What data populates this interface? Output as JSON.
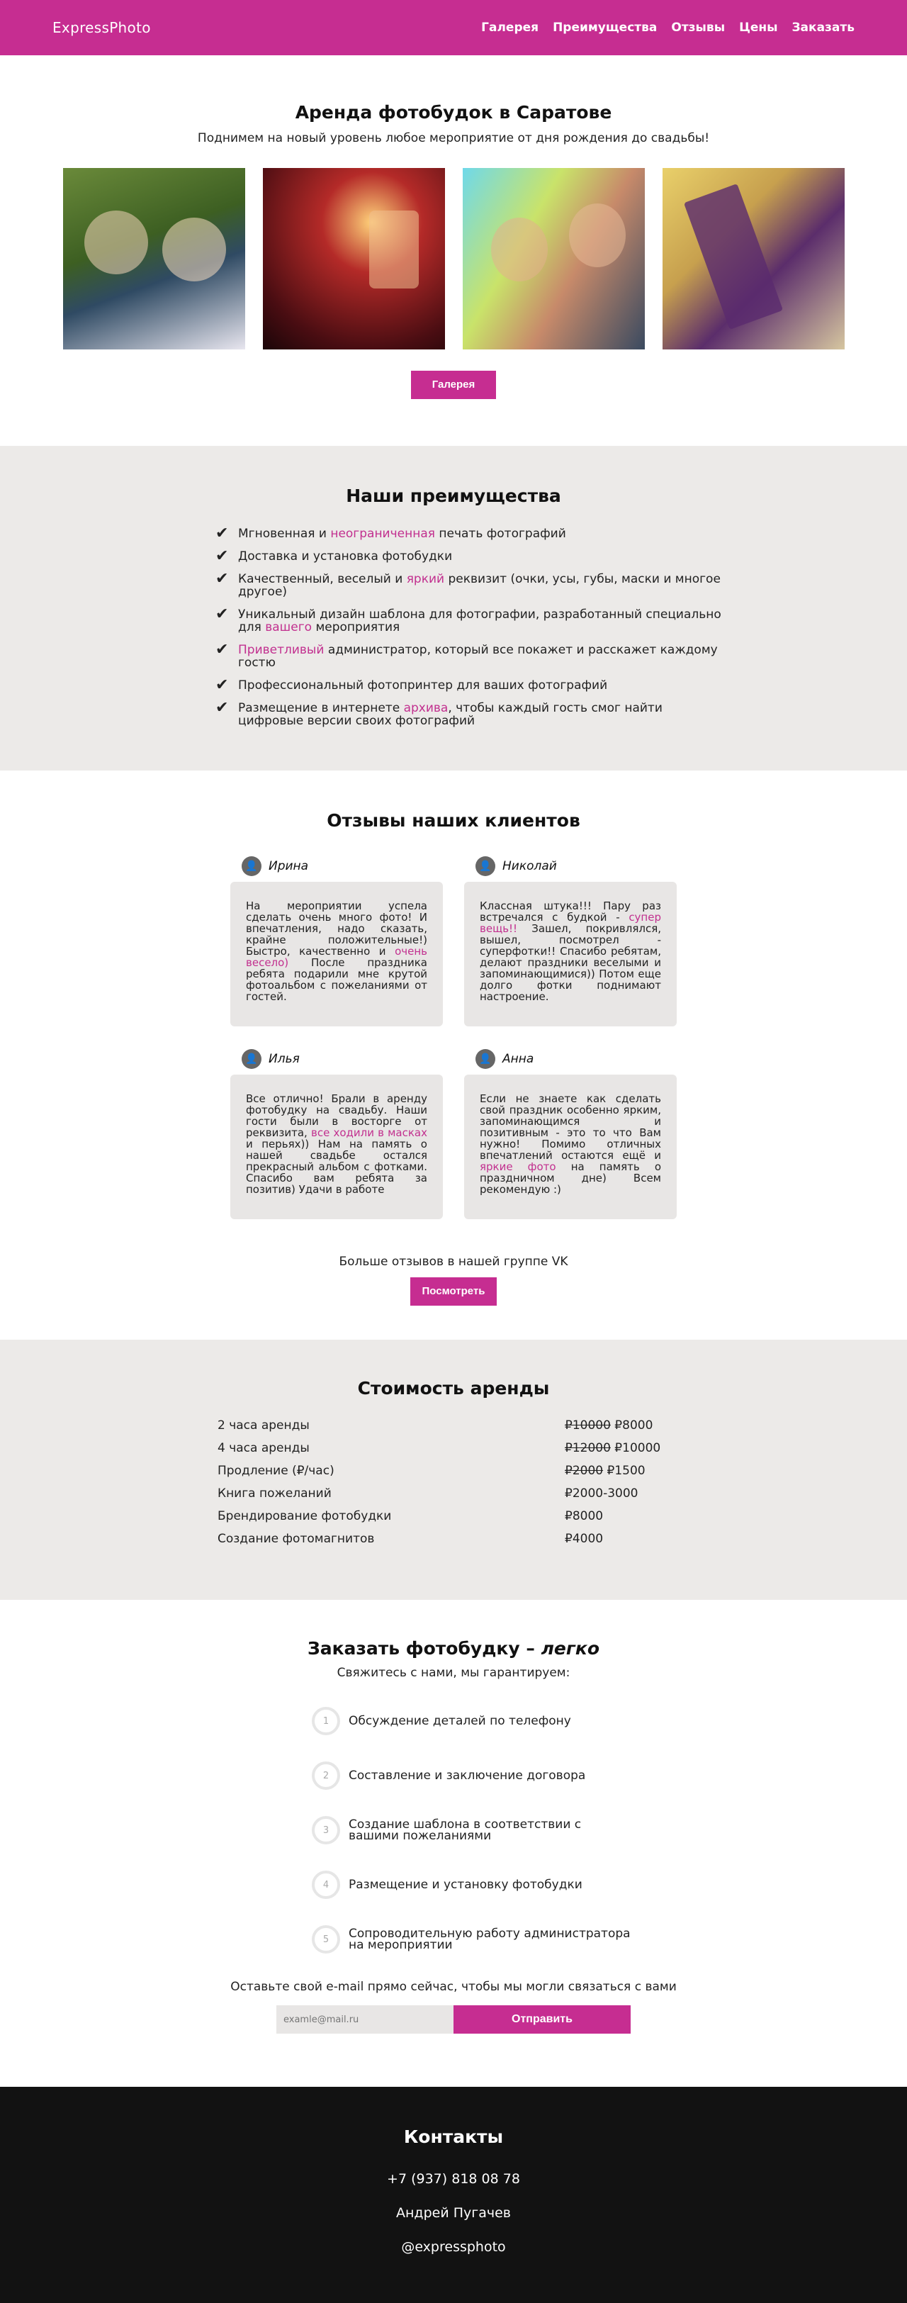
{
  "header": {
    "logo": "ExpressPhoto",
    "nav": [
      "Галерея",
      "Преимущества",
      "Отзывы",
      "Цены",
      "Заказать"
    ]
  },
  "gallery": {
    "title": "Аренда фотобудок в Саратове",
    "subtitle": "Поднимем на новый уровень любое мероприятие от дня рождения до свадьбы!",
    "button": "Галерея"
  },
  "advantages": {
    "title": "Наши преимущества",
    "items": [
      {
        "before": "Мгновенная и ",
        "accent": "неограниченная",
        "after": " печать фотографий"
      },
      {
        "before": "Доставка и установка фотобудки",
        "accent": "",
        "after": ""
      },
      {
        "before": "Качественный, веселый и ",
        "accent": "яркий",
        "after": " реквизит (очки, усы, губы, маски и многое другое)"
      },
      {
        "before": "Уникальный дизайн шаблона для фотографии, разработанный специально для ",
        "accent": "вашего",
        "after": " мероприятия"
      },
      {
        "before": "",
        "accent": "Приветливый",
        "after": " администратор, который все покажет и расскажет каждому гостю"
      },
      {
        "before": "Профессиональный фотопринтер для ваших фотографий",
        "accent": "",
        "after": ""
      },
      {
        "before": "Размещение в интернете ",
        "accent": "архива",
        "after": ", чтобы каждый гость смог найти цифровые версии своих фотографий"
      }
    ]
  },
  "reviews": {
    "title": "Отзывы наших клиентов",
    "items": [
      {
        "name": "Ирина",
        "before": "На мероприятии успела сделать очень много фото! И впечатления, надо сказать, крайне положительные!) Быстро, качественно и ",
        "accent": "очень весело)",
        "after": " После праздника ребята подарили мне крутой фотоальбом с пожеланиями от гостей."
      },
      {
        "name": "Николай",
        "before": "Классная штука!!! Пару раз встречался с будкой - ",
        "accent": "супер вещь!!",
        "after": " Зашел, покривлялся, вышел, посмотрел - суперфотки!! Спасибо ребятам, делают праздники веселыми и запоминающимися)) Потом еще долго фотки поднимают настроение."
      },
      {
        "name": "Илья",
        "before": "Все отлично! Брали в аренду фотобудку на свадьбу. Наши гости были в восторге от реквизита, ",
        "accent": "все ходили в масках",
        "after": " и перьях)) Нам на память о нашей свадьбе остался прекрасный альбом с фотками. Спасибо вам ребята за позитив) Удачи в работе"
      },
      {
        "name": "Анна",
        "before": "Если не знаете как сделать свой праздник особенно ярким, запоминающимся и позитивным - это то что Вам нужно! Помимо отличных впечатлений остаются ещё и ",
        "accent": "яркие фото",
        "after": " на память о праздничном дне) Всем рекомендую :)"
      }
    ],
    "more_text": "Больше отзывов в нашей группе VK",
    "more_button": "Посмотреть"
  },
  "prices": {
    "title": "Стоимость аренды",
    "rows": [
      {
        "name": "2 часа аренды",
        "old": "₽10000",
        "new": " ₽8000"
      },
      {
        "name": "4 часа аренды",
        "old": "₽12000",
        "new": " ₽10000"
      },
      {
        "name": "Продление (₽/час)",
        "old": "₽2000",
        "new": " ₽1500"
      },
      {
        "name": "Книга пожеланий",
        "old": "",
        "new": "₽2000-3000"
      },
      {
        "name": "Брендирование фотобудки",
        "old": "",
        "new": "₽8000"
      },
      {
        "name": "Создание фотомагнитов",
        "old": "",
        "new": "₽4000"
      }
    ]
  },
  "order": {
    "title_plain": "Заказать фотобудку – ",
    "title_em": "легко",
    "subtitle": "Свяжитесь с нами, мы гарантируем:",
    "steps": [
      {
        "num": "1",
        "text": "Обсуждение деталей по телефону"
      },
      {
        "num": "2",
        "text": "Составление и заключение договора"
      },
      {
        "num": "3",
        "text": "Создание шаблона в соответствии с вашими пожеланиями"
      },
      {
        "num": "4",
        "text": "Размещение и установку фотобудки"
      },
      {
        "num": "5",
        "text": "Сопроводительную работу администратора на мероприятии"
      }
    ],
    "email_text": "Оставьте свой e-mail прямо сейчас, чтобы мы могли связаться с вами",
    "email_placeholder": "examle@mail.ru",
    "send_button": "Отправить"
  },
  "contacts": {
    "title": "Контакты",
    "phone": "+7 (937) 818 08 78",
    "name": "Андрей Пугачев",
    "handle": "@expressphoto"
  },
  "colors": {
    "accent": "#c62d91",
    "light_bg": "#eceae8",
    "footer_bg": "#121212"
  }
}
